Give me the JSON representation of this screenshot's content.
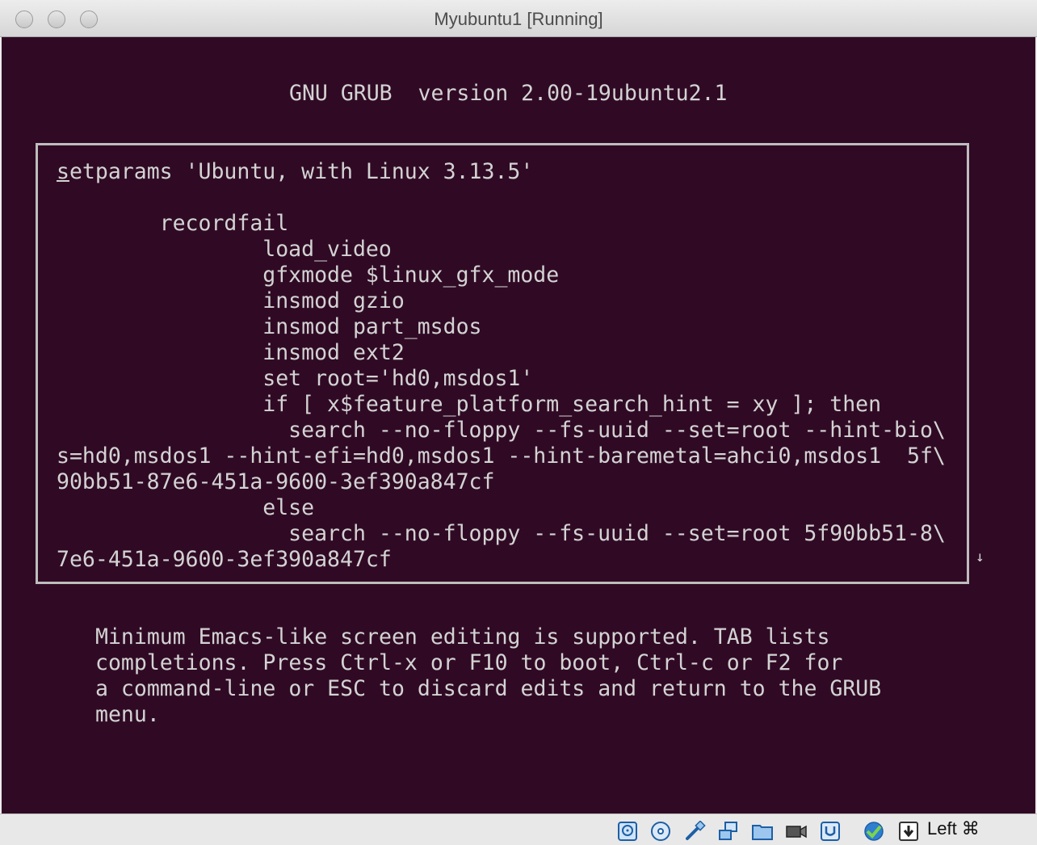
{
  "window": {
    "title": "Myubuntu1 [Running]"
  },
  "grub": {
    "header": "GNU GRUB  version 2.00-19ubuntu2.1",
    "cursor_char": "s",
    "lines": [
      "etparams 'Ubuntu, with Linux 3.13.5'",
      "",
      "        recordfail",
      "                load_video",
      "                gfxmode $linux_gfx_mode",
      "                insmod gzio",
      "                insmod part_msdos",
      "                insmod ext2",
      "                set root='hd0,msdos1'",
      "                if [ x$feature_platform_search_hint = xy ]; then",
      "                  search --no-floppy --fs-uuid --set=root --hint-bio\\",
      "s=hd0,msdos1 --hint-efi=hd0,msdos1 --hint-baremetal=ahci0,msdos1  5f\\",
      "90bb51-87e6-451a-9600-3ef390a847cf",
      "                else",
      "                  search --no-floppy --fs-uuid --set=root 5f90bb51-8\\",
      "7e6-451a-9600-3ef390a847cf"
    ],
    "more_indicator": "↓",
    "help": [
      "Minimum Emacs-like screen editing is supported. TAB lists",
      "completions. Press Ctrl-x or F10 to boot, Ctrl-c or F2 for",
      "a command-line or ESC to discard edits and return to the GRUB",
      "menu."
    ]
  },
  "statusbar": {
    "host_key": "Left ⌘",
    "icons": [
      "hard-disk-icon",
      "optical-drive-icon",
      "usb-icon",
      "network-icon",
      "shared-folders-icon",
      "video-capture-icon",
      "display-icon",
      "virtualization-icon",
      "mouse-integration-icon"
    ]
  }
}
